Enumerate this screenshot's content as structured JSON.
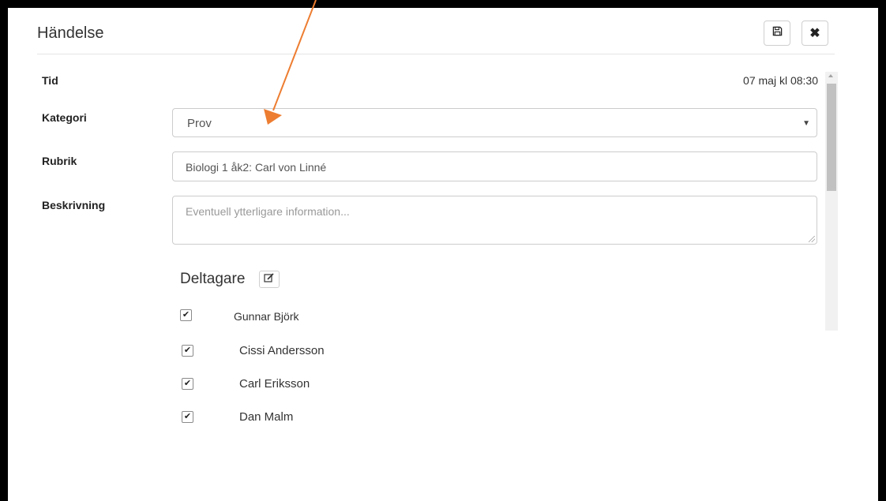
{
  "dialog": {
    "title": "Händelse"
  },
  "fields": {
    "tid": {
      "label": "Tid",
      "value": "07 maj kl 08:30"
    },
    "kategori": {
      "label": "Kategori",
      "value": "Prov"
    },
    "rubrik": {
      "label": "Rubrik",
      "value": "Biologi 1 åk2: Carl von Linné"
    },
    "beskrivning": {
      "label": "Beskrivning",
      "placeholder": "Eventuell ytterligare information..."
    }
  },
  "participants": {
    "title": "Deltagare",
    "items": [
      {
        "name": "Gunnar Björk",
        "checked": true
      },
      {
        "name": "Cissi Andersson",
        "checked": true
      },
      {
        "name": "Carl Eriksson",
        "checked": true
      },
      {
        "name": "Dan Malm",
        "checked": true
      }
    ]
  },
  "colors": {
    "annotation_arrow": "#ed7d31",
    "frame": "#000000"
  },
  "icons": {
    "save": "floppy-disk-icon",
    "close": "close-icon",
    "edit": "edit-icon",
    "check": "checkmark-icon"
  }
}
